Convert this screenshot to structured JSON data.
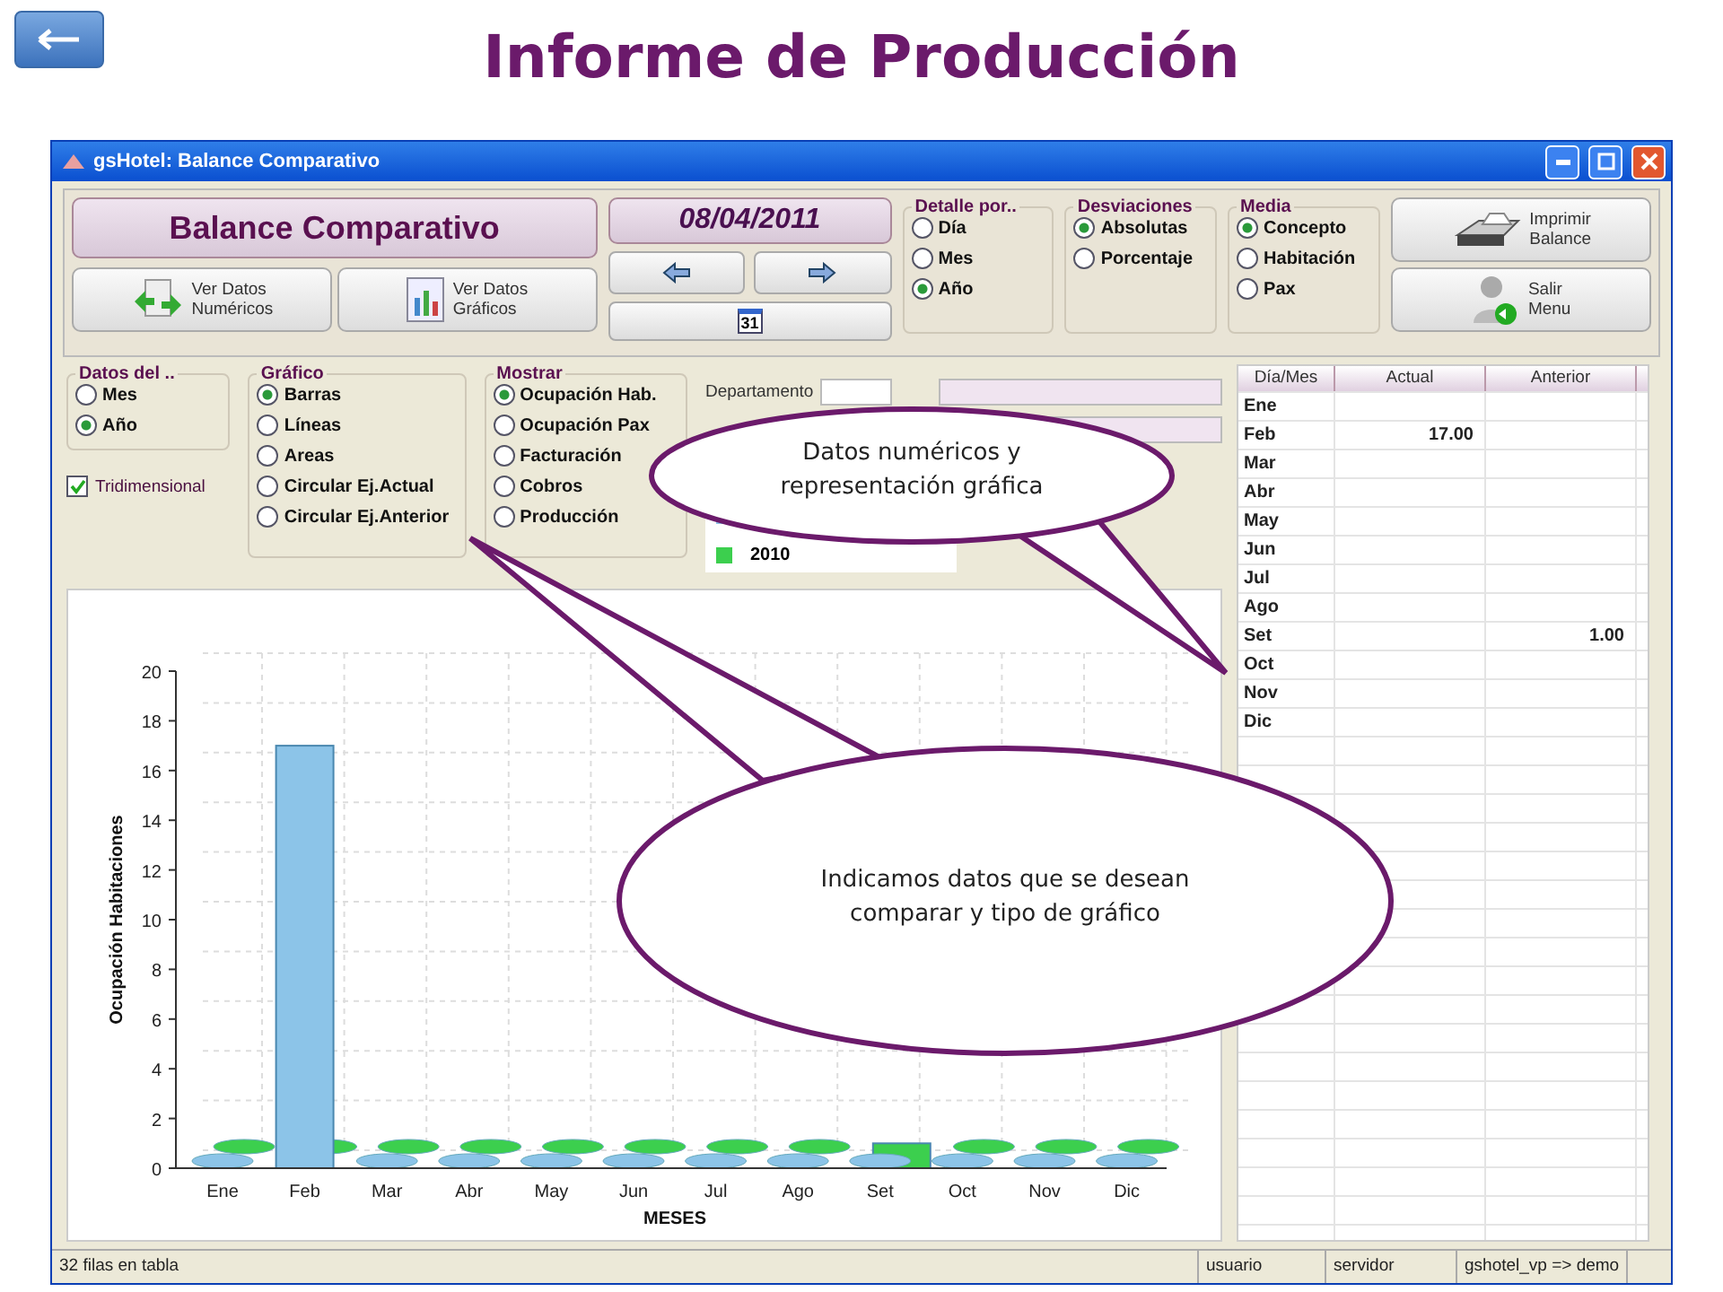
{
  "slide": {
    "title": "Informe de Producción"
  },
  "window": {
    "title": "gsHotel: Balance Comparativo"
  },
  "header": {
    "title": "Balance Comparativo",
    "date": "08/04/2011",
    "calendar_day": "31"
  },
  "view_buttons": [
    {
      "label": "Ver Datos\nNuméricos",
      "kind": "numbers"
    },
    {
      "label": "Ver Datos\nGráficos",
      "kind": "chart"
    }
  ],
  "top_options": [
    {
      "title": "Detalle por..",
      "options": [
        {
          "label": "Día",
          "selected": false
        },
        {
          "label": "Mes",
          "selected": false
        },
        {
          "label": "Año",
          "selected": true
        }
      ]
    },
    {
      "title": "Desviaciones",
      "options": [
        {
          "label": "Absolutas",
          "selected": true
        },
        {
          "label": "Porcentaje",
          "selected": false
        }
      ]
    },
    {
      "title": "Media",
      "options": [
        {
          "label": "Concepto",
          "selected": true
        },
        {
          "label": "Habitación",
          "selected": false
        },
        {
          "label": "Pax",
          "selected": false
        }
      ]
    }
  ],
  "action_buttons": [
    {
      "label": "Imprimir\nBalance",
      "kind": "print"
    },
    {
      "label": "Salir\nMenu",
      "kind": "exit"
    }
  ],
  "chart_options": [
    {
      "title": "Datos del ..",
      "options": [
        {
          "label": "Mes",
          "selected": false
        },
        {
          "label": "Año",
          "selected": true
        }
      ]
    },
    {
      "title": "Gráfico",
      "options": [
        {
          "label": "Barras",
          "selected": true
        },
        {
          "label": "Líneas",
          "selected": false
        },
        {
          "label": "Areas",
          "selected": false
        },
        {
          "label": "Circular Ej.Actual",
          "selected": false
        },
        {
          "label": "Circular Ej.Anterior",
          "selected": false
        }
      ]
    },
    {
      "title": "Mostrar",
      "options": [
        {
          "label": "Ocupación Hab.",
          "selected": true
        },
        {
          "label": "Ocupación Pax",
          "selected": false
        },
        {
          "label": "Facturación",
          "selected": false
        },
        {
          "label": "Cobros",
          "selected": false
        },
        {
          "label": "Producción",
          "selected": false
        }
      ]
    }
  ],
  "tridimensional": {
    "label": "Tridimensional",
    "checked": true
  },
  "department": {
    "label": "Departamento"
  },
  "chart": {
    "chart_data": {
      "type": "bar",
      "xlabel": "MESES",
      "ylabel": "Ocupación Habitaciones",
      "categories": [
        "Ene",
        "Feb",
        "Mar",
        "Abr",
        "May",
        "Jun",
        "Jul",
        "Ago",
        "Set",
        "Oct",
        "Nov",
        "Dic"
      ],
      "ylim": [
        0,
        20
      ],
      "yticks": [
        0,
        2,
        4,
        6,
        8,
        10,
        12,
        14,
        16,
        18,
        20
      ],
      "series": [
        {
          "color": "#8cc4e8",
          "values": [
            0,
            17,
            0,
            0,
            0,
            0,
            0,
            0,
            0,
            0,
            0,
            0
          ]
        },
        {
          "name": "2010",
          "color": "#3ccf4e",
          "values": [
            0,
            0,
            0,
            0,
            0,
            0,
            0,
            0,
            1,
            0,
            0,
            0
          ]
        }
      ]
    }
  },
  "table": {
    "columns": [
      "Día/Mes",
      "Actual",
      "Anterior"
    ],
    "rows": [
      {
        "month": "Ene"
      },
      {
        "month": "Feb",
        "actual": "17.00"
      },
      {
        "month": "Mar"
      },
      {
        "month": "Abr"
      },
      {
        "month": "May"
      },
      {
        "month": "Jun"
      },
      {
        "month": "Jul"
      },
      {
        "month": "Ago"
      },
      {
        "month": "Set",
        "anterior": "1.00"
      },
      {
        "month": "Oct"
      },
      {
        "month": "Nov"
      },
      {
        "month": "Dic"
      }
    ]
  },
  "status_bar": [
    "32 filas en tabla",
    "usuario",
    "servidor",
    "gshotel_vp => demo"
  ],
  "callouts": [
    "Datos numéricos y representación gráfica",
    "Indicamos datos que se desean comparar y tipo de gráfico"
  ]
}
